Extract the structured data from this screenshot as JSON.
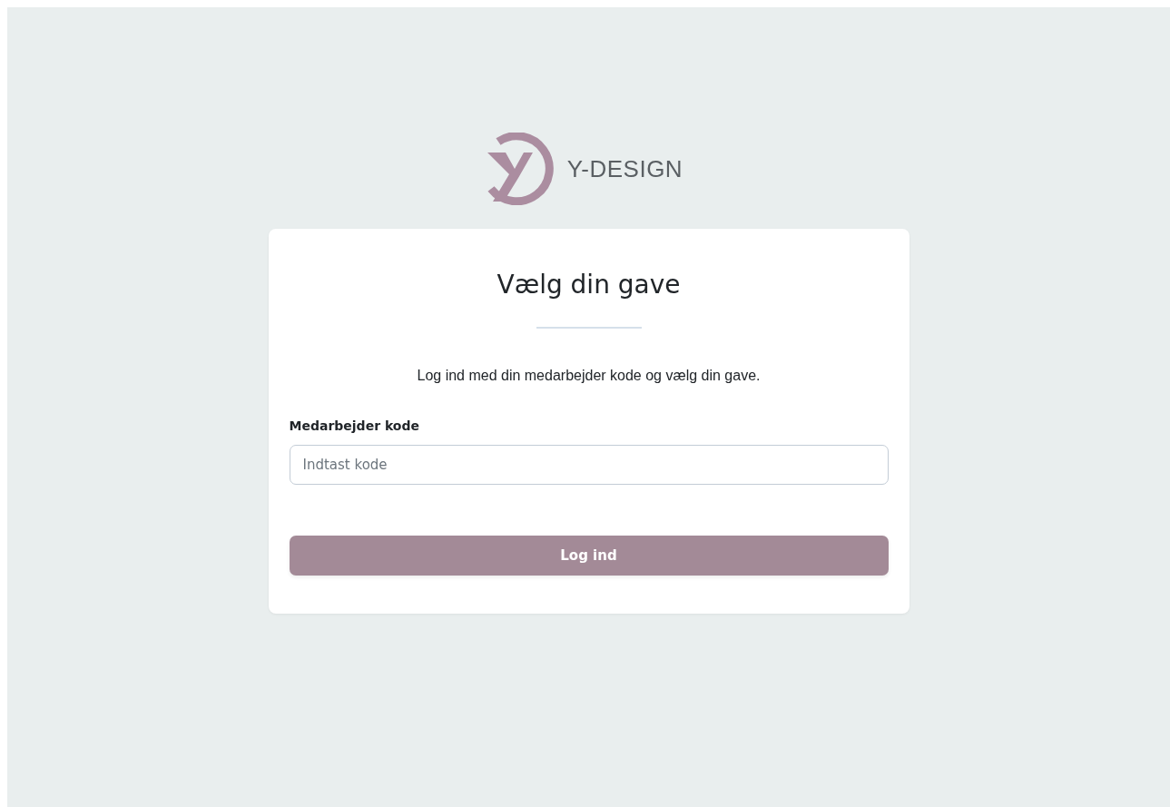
{
  "brand": {
    "name": "Y-DESIGN"
  },
  "card": {
    "title": "Vælg din gave",
    "intro": "Log ind med din medarbejder kode og vælg din gave.",
    "field": {
      "label": "Medarbejder kode",
      "placeholder": "Indtast kode"
    },
    "button": {
      "label": "Log ind",
      "disabled": false
    }
  }
}
